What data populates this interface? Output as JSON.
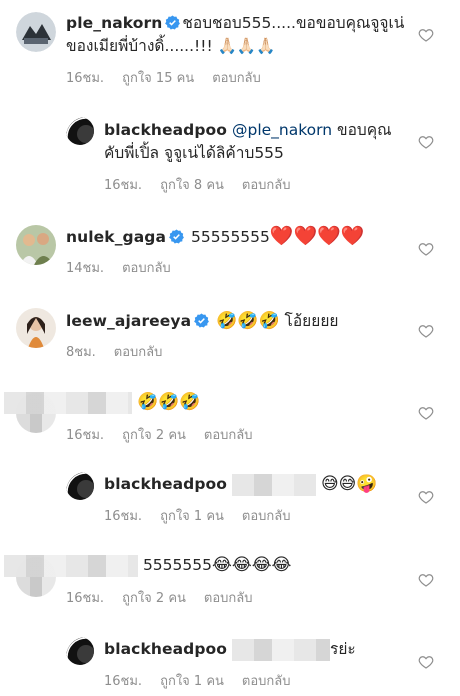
{
  "comments": [
    {
      "username": "ple_nakorn",
      "text": "ชอบชอบ555.....ขอขอบคุณจูจูเน่ของเมียพี่บ้างดิ้......!!! 🙏🏻🙏🏻🙏🏻",
      "time": "16ชม.",
      "likes": "ถูกใจ 15 คน",
      "reply": "ตอบกลับ"
    },
    {
      "username": "blackheadpoo",
      "mention": "@ple_nakorn",
      "text": " ขอบคุณคับพี่เปิ้ล จูจูเน่ได้ลิค้าบ555",
      "time": "16ชม.",
      "likes": "ถูกใจ 8 คน",
      "reply": "ตอบกลับ"
    },
    {
      "username": "nulek_gaga",
      "text": "55555555",
      "hearts": "❤️❤️❤️❤️",
      "time": "14ชม.",
      "reply": "ตอบกลับ"
    },
    {
      "username": "leew_ajareeya",
      "emojis": "🤣🤣🤣",
      "text": " โอ้ยยยย",
      "time": "8ชม.",
      "reply": "ตอบกลับ"
    },
    {
      "emojis": "🤣🤣🤣",
      "time": "16ชม.",
      "likes": "ถูกใจ 2 คน",
      "reply": "ตอบกลับ"
    },
    {
      "username": "blackheadpoo",
      "emojis": "😅😅🤪",
      "time": "16ชม.",
      "likes": "ถูกใจ 1 คน",
      "reply": "ตอบกลับ"
    },
    {
      "text": "5555555",
      "emojis": "😂😂😂😂",
      "time": "16ชม.",
      "likes": "ถูกใจ 2 คน",
      "reply": "ตอบกลับ"
    },
    {
      "username": "blackheadpoo",
      "text": "รย่ะ",
      "time": "16ชม.",
      "likes": "ถูกใจ 1 คน",
      "reply": "ตอบกลับ"
    }
  ],
  "colors": {
    "text": "#262626",
    "meta": "#8e8e8e",
    "verified": "#3897f0",
    "mention": "#00376b"
  },
  "icons": {
    "like": "heart-outline-icon",
    "verified": "verified-badge-icon"
  }
}
